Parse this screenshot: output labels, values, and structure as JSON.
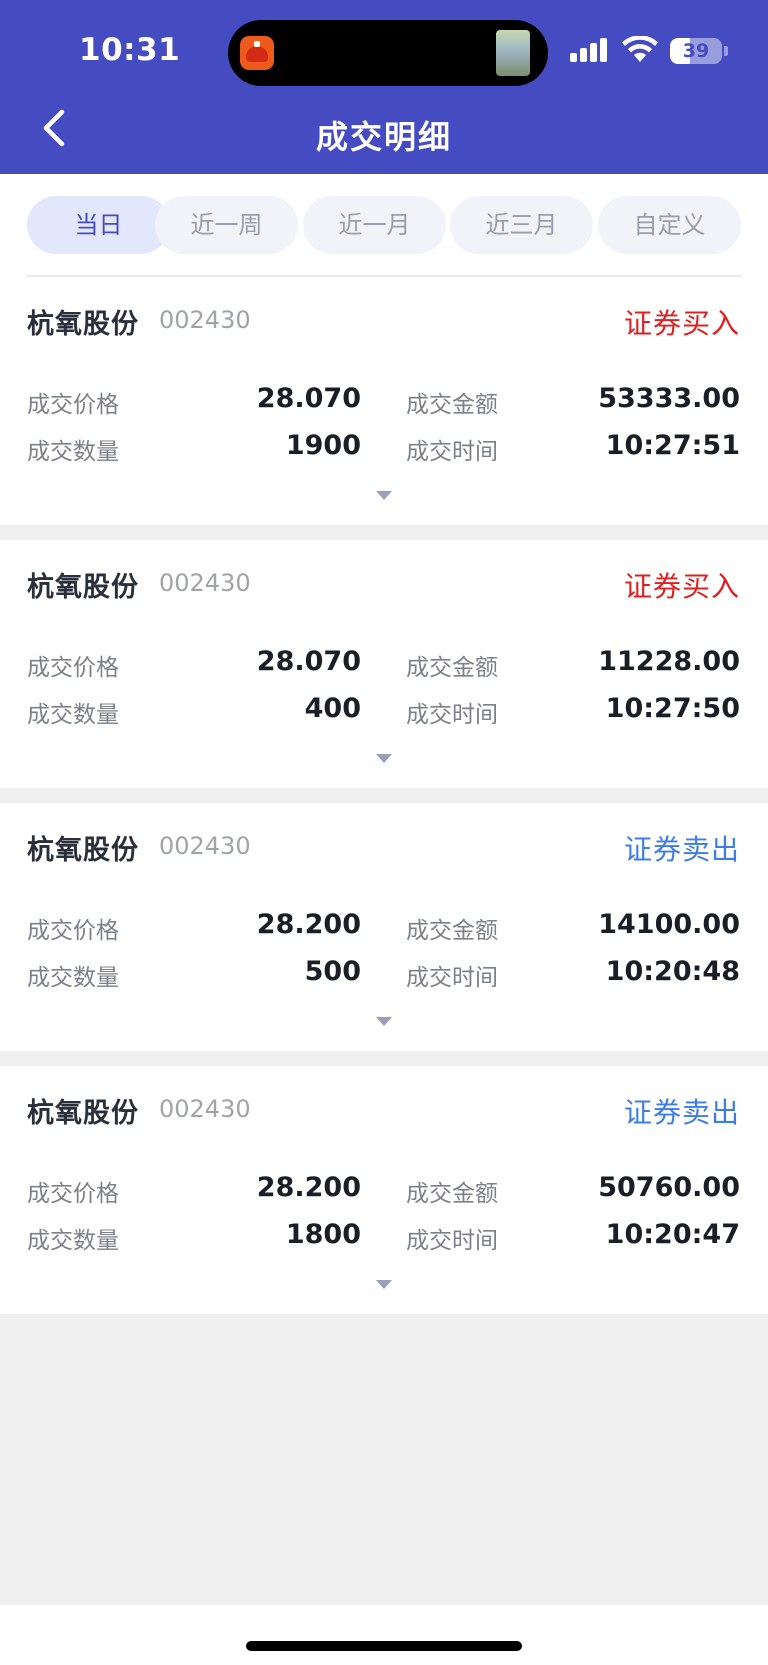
{
  "status_bar": {
    "time": "10:31",
    "battery": "39",
    "battery_level": 0.39,
    "icons": [
      "app-icon",
      "cellular-signal-icon",
      "wifi-icon",
      "battery-icon"
    ]
  },
  "header": {
    "title": "成交明细",
    "back_icon": "chevron-left-icon",
    "background_color": "#454cc2"
  },
  "tabs": [
    {
      "label": "当日",
      "active": true
    },
    {
      "label": "近一周",
      "active": false
    },
    {
      "label": "近一月",
      "active": false
    },
    {
      "label": "近三月",
      "active": false
    },
    {
      "label": "自定义",
      "active": false
    }
  ],
  "labels": {
    "price": "成交价格",
    "quantity": "成交数量",
    "amount": "成交金额",
    "time": "成交时间"
  },
  "trades": [
    {
      "name": "杭氧股份",
      "code": "002430",
      "type": "证券买入",
      "side": "buy",
      "price": "28.070",
      "quantity": "1900",
      "amount": "53333.00",
      "time": "10:27:51"
    },
    {
      "name": "杭氧股份",
      "code": "002430",
      "type": "证券买入",
      "side": "buy",
      "price": "28.070",
      "quantity": "400",
      "amount": "11228.00",
      "time": "10:27:50"
    },
    {
      "name": "杭氧股份",
      "code": "002430",
      "type": "证券卖出",
      "side": "sell",
      "price": "28.200",
      "quantity": "500",
      "amount": "14100.00",
      "time": "10:20:48"
    },
    {
      "name": "杭氧股份",
      "code": "002430",
      "type": "证券卖出",
      "side": "sell",
      "price": "28.200",
      "quantity": "1800",
      "amount": "50760.00",
      "time": "10:20:47"
    }
  ],
  "colors": {
    "buy": "#e02020",
    "sell": "#3e7ce8",
    "accent": "#454cc2"
  }
}
